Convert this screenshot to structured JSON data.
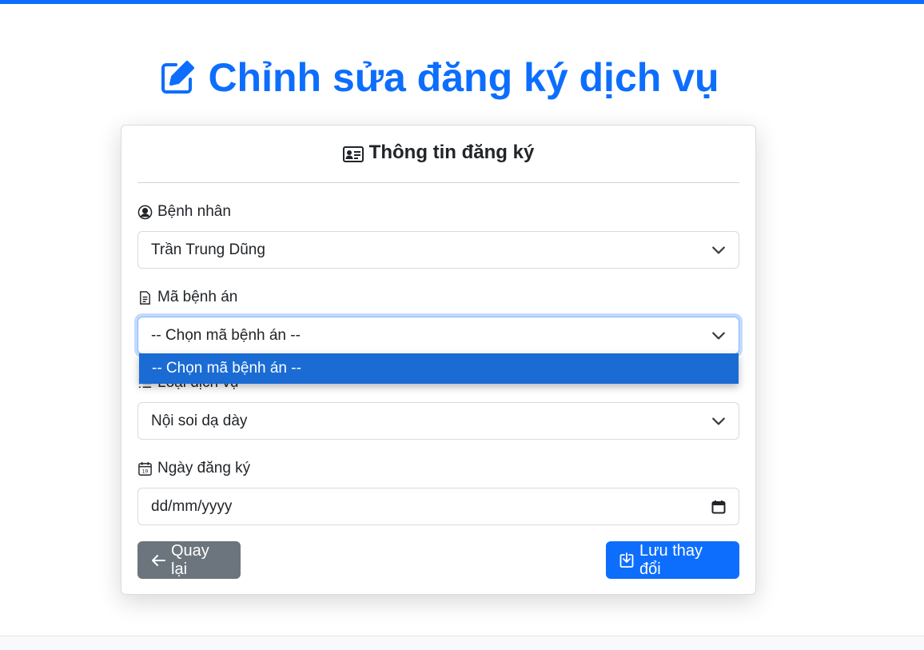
{
  "page": {
    "title": "Chỉnh sửa đăng ký dịch vụ",
    "title_icon": "edit-square-icon",
    "accent_color": "#0d6efd"
  },
  "card": {
    "header": "Thông tin đăng ký",
    "header_icon": "person-vcard-icon"
  },
  "form": {
    "patient": {
      "label": "Bệnh nhân",
      "icon": "person-circle-icon",
      "value": "Trần Trung Dũng"
    },
    "record": {
      "label": "Mã bệnh án",
      "icon": "file-text-icon",
      "value": "-- Chọn mã bệnh án --",
      "options": [
        "-- Chọn mã bệnh án --"
      ]
    },
    "service_type": {
      "label": "Loại dịch vụ",
      "icon": "list-icon",
      "value": "Nội soi dạ dày"
    },
    "register_date": {
      "label": "Ngày đăng ký",
      "icon": "calendar-icon",
      "placeholder": "dd/mm/yyyy"
    }
  },
  "buttons": {
    "back": {
      "label": "Quay lại",
      "icon": "arrow-left-icon",
      "color": "#6c757d"
    },
    "save": {
      "label": "Lưu thay đổi",
      "icon": "download-box-icon",
      "color": "#0d6efd"
    }
  }
}
